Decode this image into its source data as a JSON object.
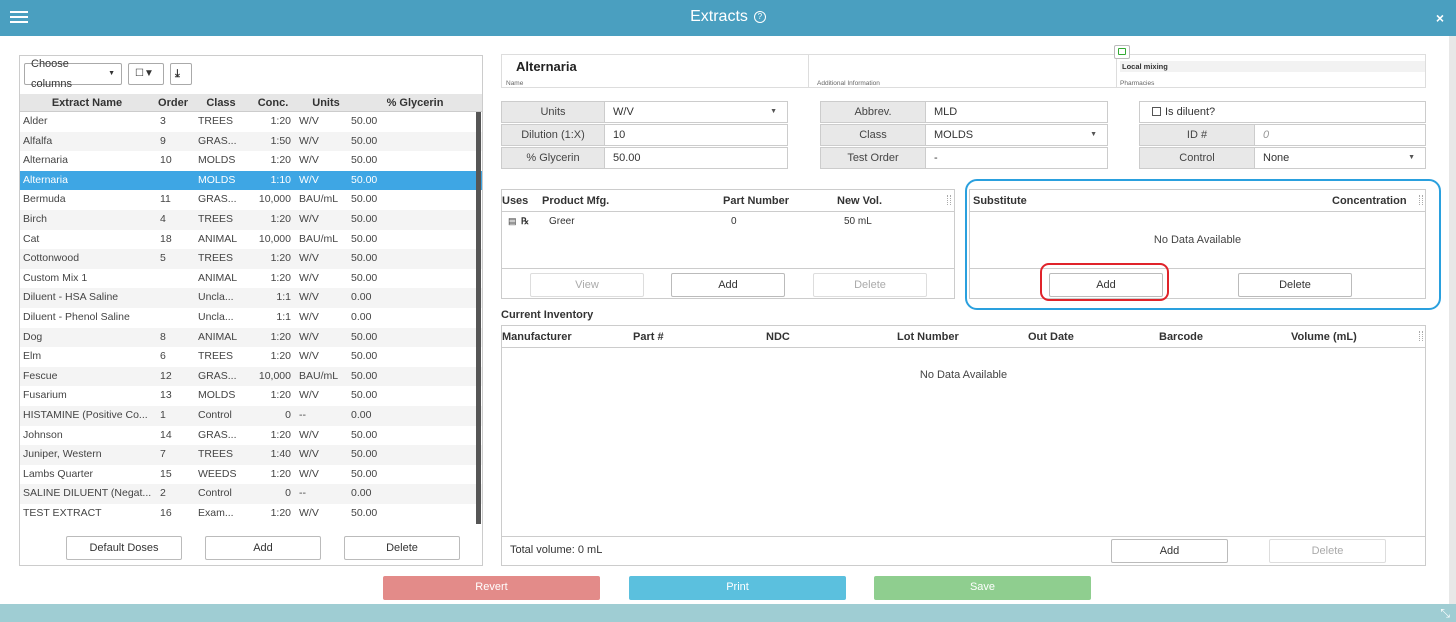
{
  "window": {
    "title": "Extracts",
    "help_icon": "?",
    "close_icon": "×",
    "resize_icon": "⤡"
  },
  "left": {
    "choose_columns": "Choose columns",
    "columns": [
      "Extract Name",
      "Order",
      "Class",
      "Conc.",
      "Units",
      "% Glycerin"
    ],
    "rows": [
      {
        "name": "Alder",
        "order": "3",
        "class": "TREES",
        "conc": "1:20",
        "units": "W/V",
        "glycerin": "50.00"
      },
      {
        "name": "Alfalfa",
        "order": "9",
        "class": "GRAS...",
        "conc": "1:50",
        "units": "W/V",
        "glycerin": "50.00"
      },
      {
        "name": "Alternaria",
        "order": "10",
        "class": "MOLDS",
        "conc": "1:20",
        "units": "W/V",
        "glycerin": "50.00"
      },
      {
        "name": "Alternaria",
        "order": "",
        "class": "MOLDS",
        "conc": "1:10",
        "units": "W/V",
        "glycerin": "50.00",
        "selected": true
      },
      {
        "name": "Bermuda",
        "order": "11",
        "class": "GRAS...",
        "conc": "10,000",
        "units": "BAU/mL",
        "glycerin": "50.00"
      },
      {
        "name": "Birch",
        "order": "4",
        "class": "TREES",
        "conc": "1:20",
        "units": "W/V",
        "glycerin": "50.00"
      },
      {
        "name": "Cat",
        "order": "18",
        "class": "ANIMAL",
        "conc": "10,000",
        "units": "BAU/mL",
        "glycerin": "50.00"
      },
      {
        "name": "Cottonwood",
        "order": "5",
        "class": "TREES",
        "conc": "1:20",
        "units": "W/V",
        "glycerin": "50.00"
      },
      {
        "name": "Custom Mix 1",
        "order": "",
        "class": "ANIMAL",
        "conc": "1:20",
        "units": "W/V",
        "glycerin": "50.00"
      },
      {
        "name": "Diluent - HSA Saline",
        "order": "",
        "class": "Uncla...",
        "conc": "1:1",
        "units": "W/V",
        "glycerin": "0.00"
      },
      {
        "name": "Diluent - Phenol Saline",
        "order": "",
        "class": "Uncla...",
        "conc": "1:1",
        "units": "W/V",
        "glycerin": "0.00"
      },
      {
        "name": "Dog",
        "order": "8",
        "class": "ANIMAL",
        "conc": "1:20",
        "units": "W/V",
        "glycerin": "50.00"
      },
      {
        "name": "Elm",
        "order": "6",
        "class": "TREES",
        "conc": "1:20",
        "units": "W/V",
        "glycerin": "50.00"
      },
      {
        "name": "Fescue",
        "order": "12",
        "class": "GRAS...",
        "conc": "10,000",
        "units": "BAU/mL",
        "glycerin": "50.00"
      },
      {
        "name": "Fusarium",
        "order": "13",
        "class": "MOLDS",
        "conc": "1:20",
        "units": "W/V",
        "glycerin": "50.00"
      },
      {
        "name": "HISTAMINE (Positive Co...",
        "order": "1",
        "class": "Control",
        "conc": "0",
        "units": "--",
        "glycerin": "0.00"
      },
      {
        "name": "Johnson",
        "order": "14",
        "class": "GRAS...",
        "conc": "1:20",
        "units": "W/V",
        "glycerin": "50.00"
      },
      {
        "name": "Juniper, Western",
        "order": "7",
        "class": "TREES",
        "conc": "1:40",
        "units": "W/V",
        "glycerin": "50.00"
      },
      {
        "name": "Lambs Quarter",
        "order": "15",
        "class": "WEEDS",
        "conc": "1:20",
        "units": "W/V",
        "glycerin": "50.00"
      },
      {
        "name": "SALINE DILUENT (Negat...",
        "order": "2",
        "class": "Control",
        "conc": "0",
        "units": "--",
        "glycerin": "0.00"
      },
      {
        "name": "TEST EXTRACT",
        "order": "16",
        "class": "Exam...",
        "conc": "1:20",
        "units": "W/V",
        "glycerin": "50.00"
      }
    ],
    "buttons": {
      "default_doses": "Default Doses",
      "add": "Add",
      "delete": "Delete"
    }
  },
  "header": {
    "name": "Alternaria",
    "name_label": "Name",
    "additional_info_label": "Additional Information",
    "pharmacy_value": "Local mixing",
    "pharmacies_label": "Pharmacies"
  },
  "fields": {
    "units_label": "Units",
    "units_value": "W/V",
    "dilution_label": "Dilution (1:X)",
    "dilution_value": "10",
    "glycerin_label": "% Glycerin",
    "glycerin_value": "50.00",
    "abbrev_label": "Abbrev.",
    "abbrev_value": "MLD",
    "class_label": "Class",
    "class_value": "MOLDS",
    "test_order_label": "Test Order",
    "test_order_value": "-",
    "is_diluent_label": "Is diluent?",
    "id_label": "ID #",
    "id_value": "0",
    "control_label": "Control",
    "control_value": "None"
  },
  "product": {
    "columns": [
      "Uses",
      "Product Mfg.",
      "Part Number",
      "New Vol."
    ],
    "rows": [
      {
        "mfg": "Greer",
        "part": "0",
        "vol": "50 mL"
      }
    ],
    "buttons": {
      "view": "View",
      "add": "Add",
      "delete": "Delete"
    }
  },
  "substitute": {
    "columns": [
      "Substitute",
      "Concentration"
    ],
    "empty": "No Data Available",
    "buttons": {
      "add": "Add",
      "delete": "Delete"
    }
  },
  "inventory": {
    "title": "Current Inventory",
    "columns": [
      "Manufacturer",
      "Part #",
      "NDC",
      "Lot Number",
      "Out Date",
      "Barcode",
      "Volume (mL)"
    ],
    "empty": "No Data Available",
    "total": "Total volume: 0 mL",
    "buttons": {
      "add": "Add",
      "delete": "Delete"
    }
  },
  "actions": {
    "revert": "Revert",
    "print": "Print",
    "save": "Save"
  },
  "colors": {
    "titlebar": "#4a9fc0",
    "selected_row": "#3ea6e4",
    "revert": "#e38b89",
    "print": "#5bc0de",
    "save": "#8fce8f",
    "highlight_blue": "#2aa0de",
    "highlight_red": "#e0232a"
  }
}
